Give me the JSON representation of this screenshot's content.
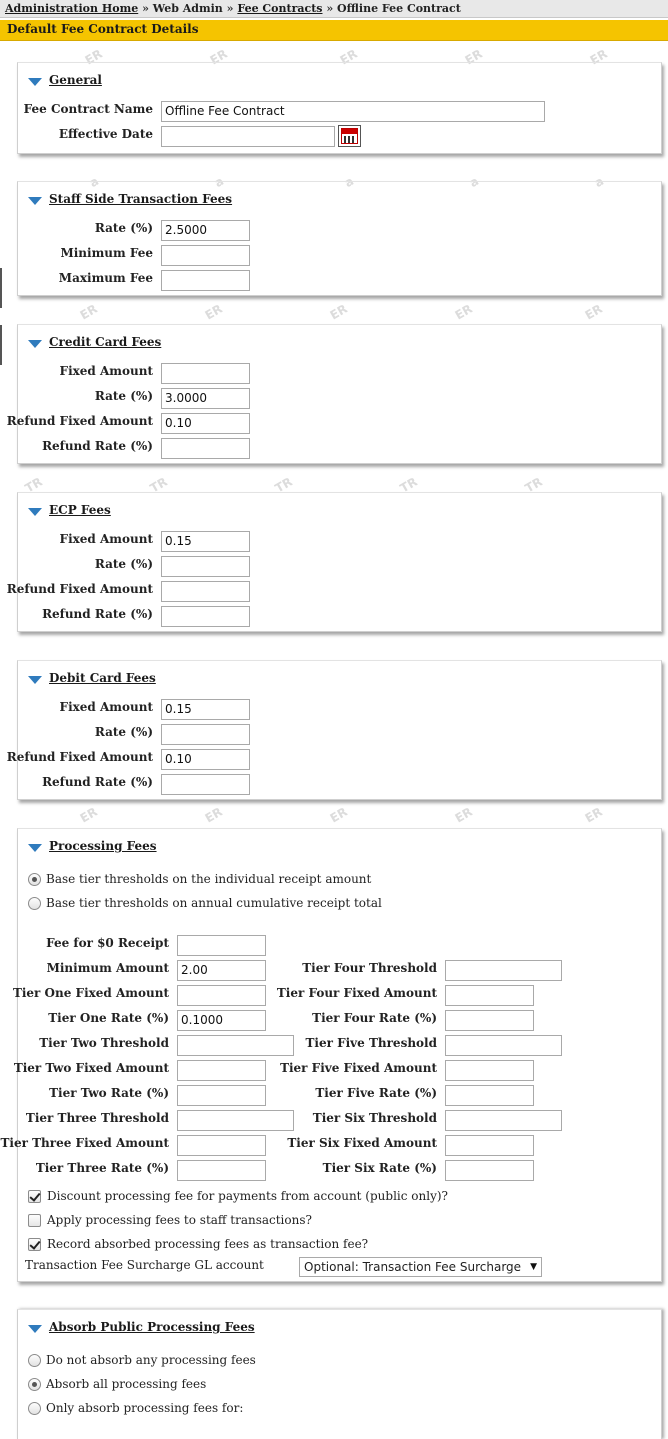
{
  "breadcrumb": {
    "home": "Administration Home",
    "web_admin": "Web Admin",
    "fee_contracts": "Fee Contracts",
    "current": "Offline Fee Contract",
    "separator": "»"
  },
  "page_title": "Default Fee Contract Details",
  "colors": {
    "title_bar": "#f5c400",
    "section_triangle": "#2f7bbd"
  },
  "general": {
    "title": "General",
    "name_label": "Fee Contract Name",
    "name_value": "Offline Fee Contract",
    "date_label": "Effective Date",
    "date_value": "",
    "calendar_icon": "calendar-icon"
  },
  "staff": {
    "title": "Staff Side Transaction Fees",
    "rate_label": "Rate (%)",
    "rate_value": "2.5000",
    "min_label": "Minimum Fee",
    "min_value": "",
    "max_label": "Maximum Fee",
    "max_value": ""
  },
  "credit": {
    "title": "Credit Card Fees",
    "fixed_label": "Fixed Amount",
    "fixed_value": "",
    "rate_label": "Rate (%)",
    "rate_value": "3.0000",
    "refund_fixed_label": "Refund Fixed Amount",
    "refund_fixed_value": "0.10",
    "refund_rate_label": "Refund Rate (%)",
    "refund_rate_value": ""
  },
  "ecp": {
    "title": "ECP Fees",
    "fixed_label": "Fixed Amount",
    "fixed_value": "0.15",
    "rate_label": "Rate (%)",
    "rate_value": "",
    "refund_fixed_label": "Refund Fixed Amount",
    "refund_fixed_value": "",
    "refund_rate_label": "Refund Rate (%)",
    "refund_rate_value": ""
  },
  "debit": {
    "title": "Debit Card Fees",
    "fixed_label": "Fixed Amount",
    "fixed_value": "0.15",
    "rate_label": "Rate (%)",
    "rate_value": "",
    "refund_fixed_label": "Refund Fixed Amount",
    "refund_fixed_value": "0.10",
    "refund_rate_label": "Refund Rate (%)",
    "refund_rate_value": ""
  },
  "processing": {
    "title": "Processing Fees",
    "radio_individual": "Base tier thresholds on the individual receipt amount",
    "radio_individual_checked": true,
    "radio_annual": "Base tier thresholds on annual cumulative receipt total",
    "radio_annual_checked": false,
    "fee_zero_label": "Fee for $0 Receipt",
    "fee_zero_value": "",
    "minimum_label": "Minimum Amount",
    "minimum_value": "2.00",
    "t1_fixed_label": "Tier One Fixed Amount",
    "t1_fixed_value": "",
    "t1_rate_label": "Tier One Rate (%)",
    "t1_rate_value": "0.1000",
    "t2_threshold_label": "Tier Two Threshold",
    "t2_threshold_value": "",
    "t2_fixed_label": "Tier Two Fixed Amount",
    "t2_fixed_value": "",
    "t2_rate_label": "Tier Two Rate (%)",
    "t2_rate_value": "",
    "t3_threshold_label": "Tier Three Threshold",
    "t3_threshold_value": "",
    "t3_fixed_label": "Tier Three Fixed Amount",
    "t3_fixed_value": "",
    "t3_rate_label": "Tier Three Rate (%)",
    "t3_rate_value": "",
    "t4_threshold_label": "Tier Four Threshold",
    "t4_threshold_value": "",
    "t4_fixed_label": "Tier Four Fixed Amount",
    "t4_fixed_value": "",
    "t4_rate_label": "Tier Four Rate (%)",
    "t4_rate_value": "",
    "t5_threshold_label": "Tier Five Threshold",
    "t5_threshold_value": "",
    "t5_fixed_label": "Tier Five Fixed Amount",
    "t5_fixed_value": "",
    "t5_rate_label": "Tier Five Rate (%)",
    "t5_rate_value": "",
    "t6_threshold_label": "Tier Six Threshold",
    "t6_threshold_value": "",
    "t6_fixed_label": "Tier Six Fixed Amount",
    "t6_fixed_value": "",
    "t6_rate_label": "Tier Six Rate (%)",
    "t6_rate_value": "",
    "discount_label": "Discount processing fee for payments from account (public only)?",
    "discount_checked": true,
    "apply_staff_label": "Apply processing fees to staff transactions?",
    "apply_staff_checked": false,
    "record_absorbed_label": "Record absorbed processing fees as transaction fee?",
    "record_absorbed_checked": true,
    "gl_label": "Transaction Fee Surcharge GL account",
    "gl_selected": "Optional: Transaction Fee Surcharge",
    "gl_arrow": "▼"
  },
  "absorb": {
    "title": "Absorb Public Processing Fees",
    "opt_none": "Do not absorb any processing fees",
    "opt_none_checked": false,
    "opt_all": "Absorb all processing fees",
    "opt_all_checked": true,
    "opt_only": "Only absorb processing fees for:",
    "opt_only_checked": false
  }
}
